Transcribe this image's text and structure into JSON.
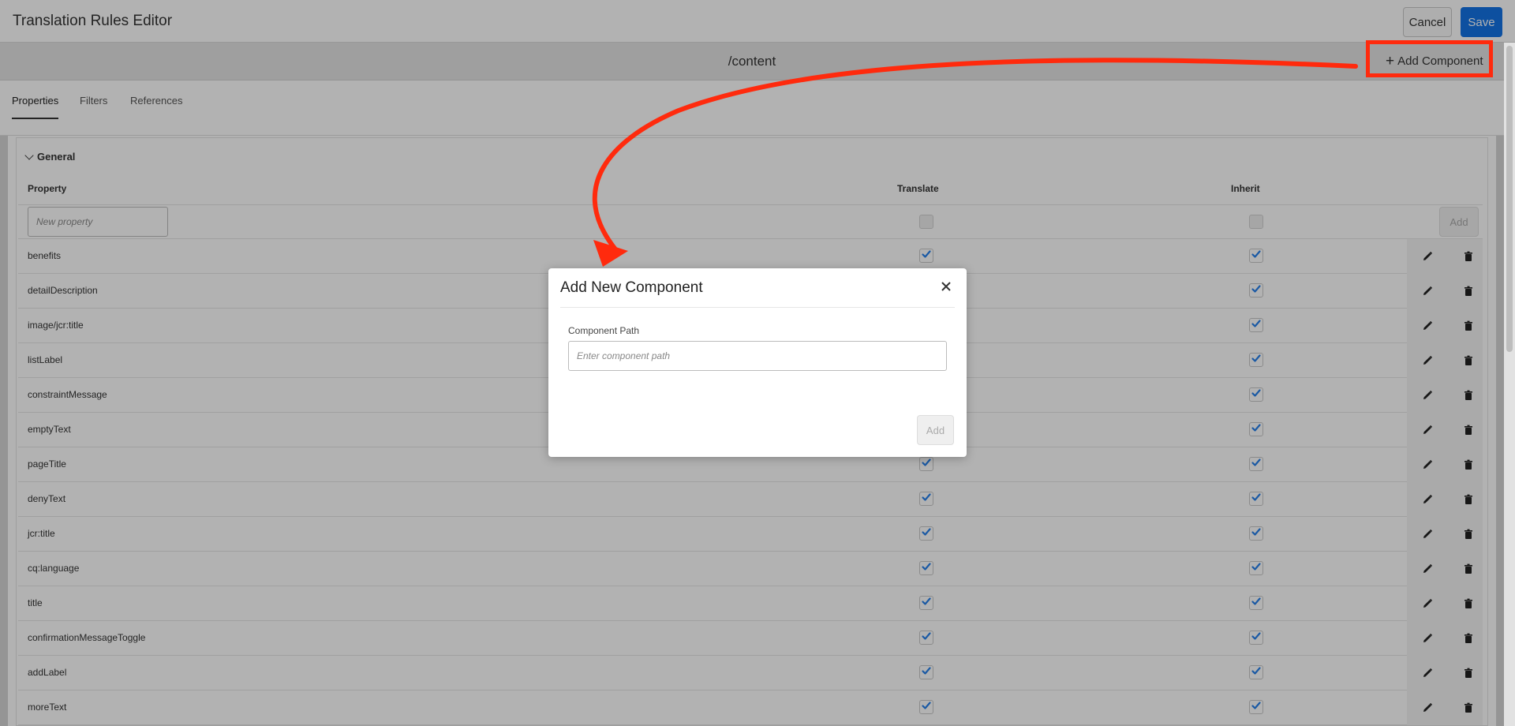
{
  "header": {
    "title": "Translation Rules Editor",
    "cancel_label": "Cancel",
    "save_label": "Save"
  },
  "pathbar": {
    "path": "/content",
    "add_component_label": "Add Component"
  },
  "tabs": [
    {
      "label": "Properties"
    },
    {
      "label": "Filters"
    },
    {
      "label": "References"
    }
  ],
  "section": {
    "title": "General",
    "columns": {
      "property": "Property",
      "translate": "Translate",
      "inherit": "Inherit"
    },
    "new_property_placeholder": "New property",
    "add_label": "Add",
    "rows": [
      {
        "name": "benefits",
        "translate": true,
        "inherit": true
      },
      {
        "name": "detailDescription",
        "translate": true,
        "inherit": true
      },
      {
        "name": "image/jcr:title",
        "translate": true,
        "inherit": true
      },
      {
        "name": "listLabel",
        "translate": true,
        "inherit": true
      },
      {
        "name": "constraintMessage",
        "translate": true,
        "inherit": true
      },
      {
        "name": "emptyText",
        "translate": true,
        "inherit": true
      },
      {
        "name": "pageTitle",
        "translate": true,
        "inherit": true
      },
      {
        "name": "denyText",
        "translate": true,
        "inherit": true
      },
      {
        "name": "jcr:title",
        "translate": true,
        "inherit": true
      },
      {
        "name": "cq:language",
        "translate": true,
        "inherit": true
      },
      {
        "name": "title",
        "translate": true,
        "inherit": true
      },
      {
        "name": "confirmationMessageToggle",
        "translate": true,
        "inherit": true
      },
      {
        "name": "addLabel",
        "translate": true,
        "inherit": true
      },
      {
        "name": "moreText",
        "translate": true,
        "inherit": true
      }
    ]
  },
  "modal": {
    "title": "Add New Component",
    "field_label": "Component Path",
    "field_placeholder": "Enter component path",
    "field_value": "",
    "add_label": "Add"
  },
  "colors": {
    "accent": "#1473e6",
    "check": "#2680eb",
    "annotation": "#ff2a0d"
  },
  "icons": [
    "plus-icon",
    "chevron-down-icon",
    "check-icon",
    "pencil-icon",
    "trash-icon",
    "close-icon"
  ]
}
